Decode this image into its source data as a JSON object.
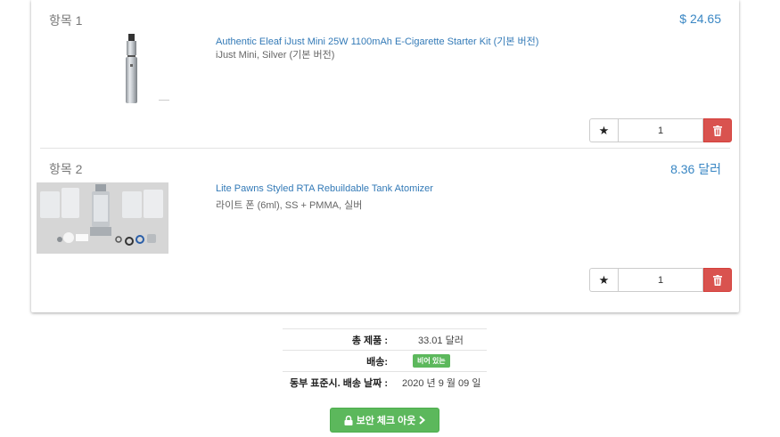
{
  "cart": {
    "items": [
      {
        "label": "항목 1",
        "price": "$ 24.65",
        "title": "Authentic Eleaf iJust Mini 25W 1100mAh E-Cigarette Starter Kit (기본 버전)",
        "subtitle": "iJust Mini, Silver (기본 버전)",
        "quantity": "1",
        "thumb_icon": "vape-pen-image"
      },
      {
        "label": "항목 2",
        "price": "8.36 달러",
        "title": "Lite Pawns Styled RTA Rebuildable Tank Atomizer",
        "subtitle": "라이트 폰 (6ml), SS + PMMA, 실버",
        "quantity": "1",
        "thumb_icon": "tank-atomizer-image"
      }
    ],
    "fav_icon": "star-icon",
    "delete_icon": "trash-icon"
  },
  "summary": {
    "total_label": "총 제품 :",
    "total_value": "33.01 달러",
    "shipping_label": "배송:",
    "shipping_badge": "비어 있는",
    "delivery_label": "동부 표준시. 배송 날짜 :",
    "delivery_value": "2020 년 9 월 09 일"
  },
  "checkout": {
    "label": "보안 체크 아웃",
    "lock_icon": "lock-icon",
    "arrow_icon": "chevron-right-icon"
  },
  "colors": {
    "link": "#337ab7",
    "price": "#3a87c4",
    "delete": "#d9534f",
    "success": "#5cb85c"
  }
}
